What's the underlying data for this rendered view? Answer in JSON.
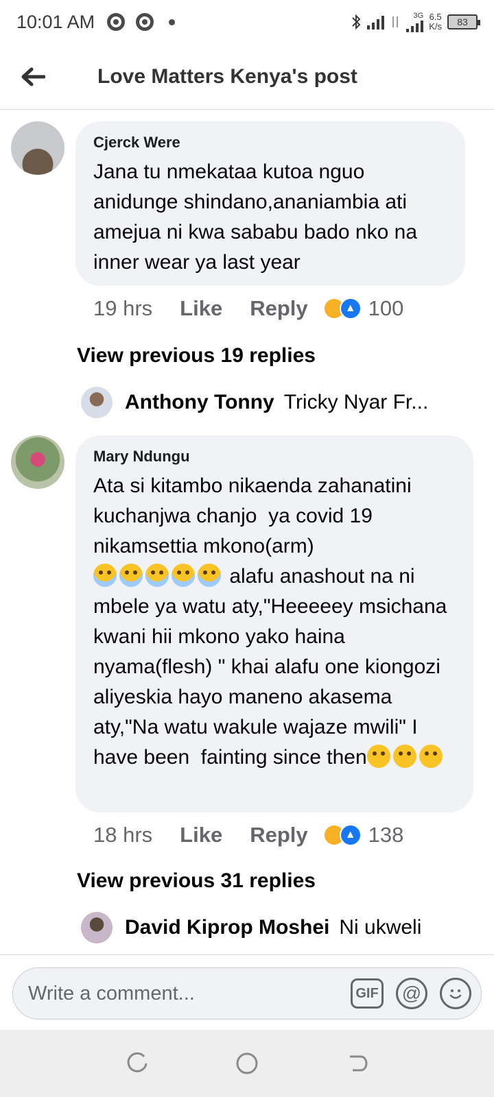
{
  "status_bar": {
    "time": "10:01 AM",
    "network": "3G",
    "speed_value": "6.5",
    "speed_unit": "K/s",
    "battery": "83"
  },
  "header": {
    "title": "Love Matters Kenya's post"
  },
  "comments": [
    {
      "author": "Cjerck Were",
      "text": "Jana tu nmekataa kutoa nguo anidunge shindano,ananiambia ati amejua ni kwa sababu bado nko na inner wear ya last year",
      "time": "19 hrs",
      "like_label": "Like",
      "reply_label": "Reply",
      "reaction_count": "100",
      "view_previous": "View previous 19 replies",
      "reply_preview": {
        "name": "Anthony Tonny",
        "text": "Tricky Nyar Fr..."
      }
    },
    {
      "author": "Mary Ndungu",
      "text_part1": "Ata si kitambo nikaenda zahanatini kuchanjwa chanjo  ya covid 19 nikamsettia mkono(arm)",
      "text_part2": " alafu anashout na ni mbele ya watu aty,\"Heeeeey msichana kwani hii mkono yako haina nyama(flesh) \" khai alafu one kiongozi aliyeskia hayo maneno akasema aty,\"Na watu wakule wajaze mwili\" I have been  fainting since then",
      "time": "18 hrs",
      "like_label": "Like",
      "reply_label": "Reply",
      "reaction_count": "138",
      "view_previous": "View previous 31 replies",
      "reply_preview": {
        "name": "David Kiprop Moshei",
        "text": "Ni ukweli"
      }
    }
  ],
  "composer": {
    "placeholder": "Write a comment...",
    "gif_label": "GIF",
    "mention_label": "@"
  },
  "icons": {
    "back": "arrow-left-icon",
    "emoji": "smiley-icon"
  }
}
